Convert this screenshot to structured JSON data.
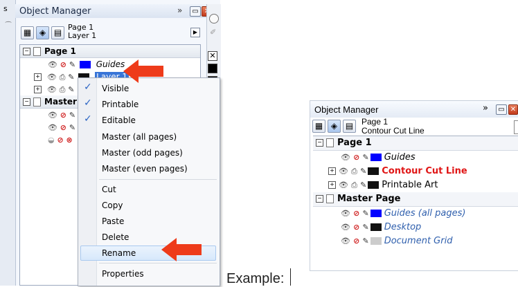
{
  "left_panel": {
    "edge_letter": "s",
    "title": "Object Manager",
    "title_chevron": "»",
    "header_page": "Page 1",
    "header_layer": "Layer 1",
    "groups": [
      {
        "label": "Page 1",
        "layers": [
          {
            "label": "Guides",
            "swatch": "#0000ff",
            "italic": true,
            "selected": false
          },
          {
            "label": "Layer 1",
            "swatch": "#111111",
            "italic": false,
            "selected": true
          },
          {
            "label": "",
            "swatch": "#111111",
            "italic": false,
            "selected": false
          }
        ]
      },
      {
        "label": "Master",
        "layers": [
          {
            "label": "",
            "swatch": "",
            "italic": false
          },
          {
            "label": "",
            "swatch": "",
            "italic": false
          },
          {
            "label": "",
            "swatch": "",
            "italic": false
          }
        ]
      }
    ]
  },
  "context_menu": {
    "items": [
      {
        "label": "Visible",
        "checked": true
      },
      {
        "label": "Printable",
        "checked": true
      },
      {
        "label": "Editable",
        "checked": true
      },
      {
        "label": "Master (all pages)",
        "checked": false
      },
      {
        "label": "Master (odd pages)",
        "checked": false
      },
      {
        "label": "Master (even pages)",
        "checked": false
      },
      {
        "label": "Cut",
        "checked": false
      },
      {
        "label": "Copy",
        "checked": false
      },
      {
        "label": "Paste",
        "checked": false
      },
      {
        "label": "Delete",
        "checked": false
      },
      {
        "label": "Rename",
        "checked": false,
        "highlighted": true
      },
      {
        "label": "Properties",
        "checked": false
      }
    ]
  },
  "example_label": "Example:",
  "right_panel": {
    "title": "Object Manager",
    "title_chevron": "»",
    "header_page": "Page 1",
    "header_layer": "Contour Cut Line",
    "rows": [
      {
        "kind": "group",
        "label": "Page 1"
      },
      {
        "kind": "layer",
        "label": "Guides",
        "style": "italic",
        "swatch": "#0000ff",
        "printable": false,
        "expand": false
      },
      {
        "kind": "layer",
        "label": "Contour Cut Line",
        "style": "red-bold",
        "swatch": "#111111",
        "printable": true,
        "expand": true
      },
      {
        "kind": "layer",
        "label": "Printable Art",
        "style": "normal",
        "swatch": "#111111",
        "printable": true,
        "expand": true
      },
      {
        "kind": "group",
        "label": "Master Page"
      },
      {
        "kind": "layer",
        "label": "Guides (all pages)",
        "style": "blue-italic",
        "swatch": "#0000ff",
        "printable": false,
        "expand": false
      },
      {
        "kind": "layer",
        "label": "Desktop",
        "style": "blue-italic",
        "swatch": "#111111",
        "printable": false,
        "expand": false
      },
      {
        "kind": "layer",
        "label": "Document Grid",
        "style": "blue-italic",
        "swatch": "#cccccc",
        "printable": false,
        "expand": false
      }
    ]
  },
  "colors": {
    "arrow": "#ee3b1a",
    "selection": "#3875d7",
    "menu_check": "#2b64c4"
  }
}
